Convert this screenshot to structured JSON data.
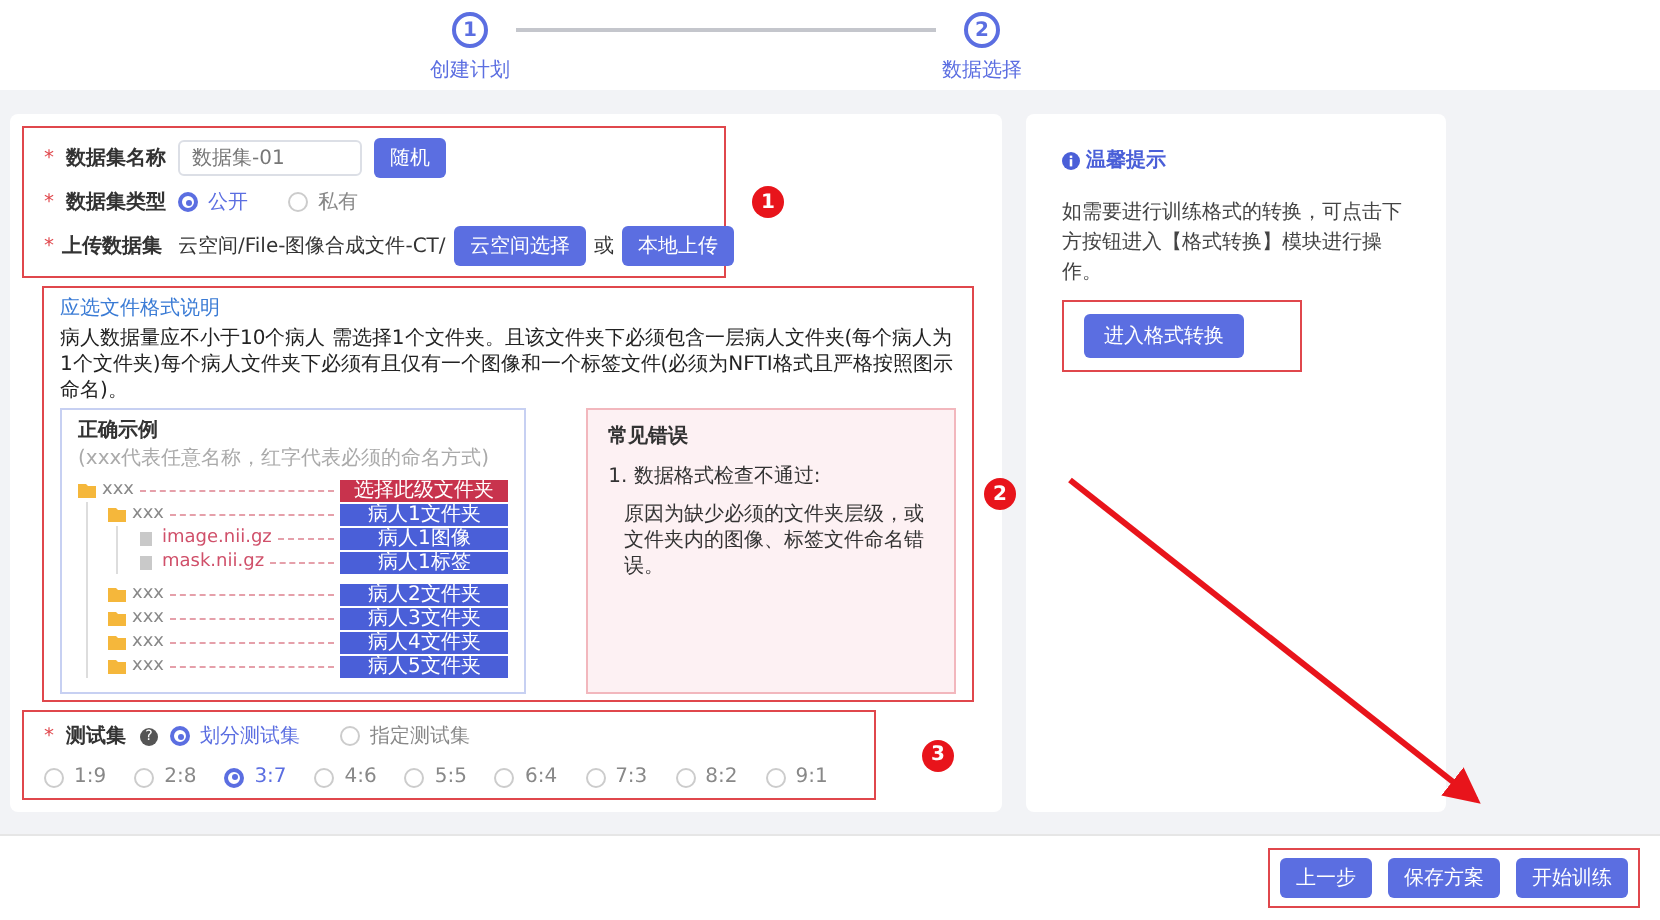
{
  "steps": [
    {
      "number": "1",
      "label": "创建计划"
    },
    {
      "number": "2",
      "label": "数据选择"
    }
  ],
  "dataset_form": {
    "name": {
      "mark": "*",
      "label": "数据集名称",
      "value": "数据集-01",
      "button": "随机"
    },
    "type": {
      "mark": "*",
      "label": "数据集类型",
      "options": [
        {
          "label": "公开",
          "selected": true
        },
        {
          "label": "私有",
          "selected": false
        }
      ]
    },
    "upload": {
      "mark": "*",
      "label": "上传数据集",
      "path": "云空间/File-图像合成文件-CT/",
      "buttons": [
        "云空间选择",
        "本地上传"
      ],
      "separator": "或"
    }
  },
  "format_help": {
    "link": "应选文件格式说明",
    "description": "病人数据量应不小于10个病人 需选择1个文件夹。且该文件夹下必须包含一层病人文件夹(每个病人为1个文件夹)每个病人文件夹下必须有且仅有一个图像和一个标签文件(必须为NFTI格式且严格按照图示命名)。",
    "example": {
      "title": "正确示例",
      "note": "(xxx代表任意名称，红字代表必须的命名方式)",
      "tree": [
        {
          "kind": "folder",
          "name": "xxx",
          "tag": "选择此级文件夹",
          "color": "#c8334d",
          "children": [
            {
              "kind": "folder",
              "name": "xxx",
              "tag": "病人1文件夹",
              "color": "#4a5fd8",
              "children": [
                {
                  "kind": "file",
                  "name": "image.nii.gz",
                  "tag": "病人1图像",
                  "color": "#4a5fd8"
                },
                {
                  "kind": "file",
                  "name": "mask.nii.gz",
                  "tag": "病人1标签",
                  "color": "#4a5fd8"
                }
              ]
            },
            {
              "kind": "folder",
              "name": "xxx",
              "tag": "病人2文件夹",
              "color": "#4a5fd8"
            },
            {
              "kind": "folder",
              "name": "xxx",
              "tag": "病人3文件夹",
              "color": "#4a5fd8"
            },
            {
              "kind": "folder",
              "name": "xxx",
              "tag": "病人4文件夹",
              "color": "#4a5fd8"
            },
            {
              "kind": "folder",
              "name": "xxx",
              "tag": "病人5文件夹",
              "color": "#4a5fd8"
            }
          ]
        }
      ]
    },
    "errors": {
      "title": "常见错误",
      "heading": "1. 数据格式检查不通过:",
      "reason": "原因为缺少必须的文件夹层级，或文件夹内的图像、标签文件命名错误。"
    }
  },
  "test_set": {
    "mark": "*",
    "label": "测试集",
    "help": "?",
    "modes": [
      {
        "label": "划分测试集",
        "selected": true
      },
      {
        "label": "指定测试集",
        "selected": false
      }
    ],
    "ratios": [
      {
        "label": "1:9",
        "selected": false
      },
      {
        "label": "2:8",
        "selected": false
      },
      {
        "label": "3:7",
        "selected": true
      },
      {
        "label": "4:6",
        "selected": false
      },
      {
        "label": "5:5",
        "selected": false
      },
      {
        "label": "6:4",
        "selected": false
      },
      {
        "label": "7:3",
        "selected": false
      },
      {
        "label": "8:2",
        "selected": false
      },
      {
        "label": "9:1",
        "selected": false
      }
    ]
  },
  "tip": {
    "title": "温馨提示",
    "text": "如需要进行训练格式的转换，可点击下方按钮进入【格式转换】模块进行操作。",
    "button": "进入格式转换"
  },
  "footer": {
    "buttons": [
      "上一步",
      "保存方案",
      "开始训练"
    ]
  },
  "annotations": {
    "badges": [
      "1",
      "2",
      "3"
    ]
  }
}
